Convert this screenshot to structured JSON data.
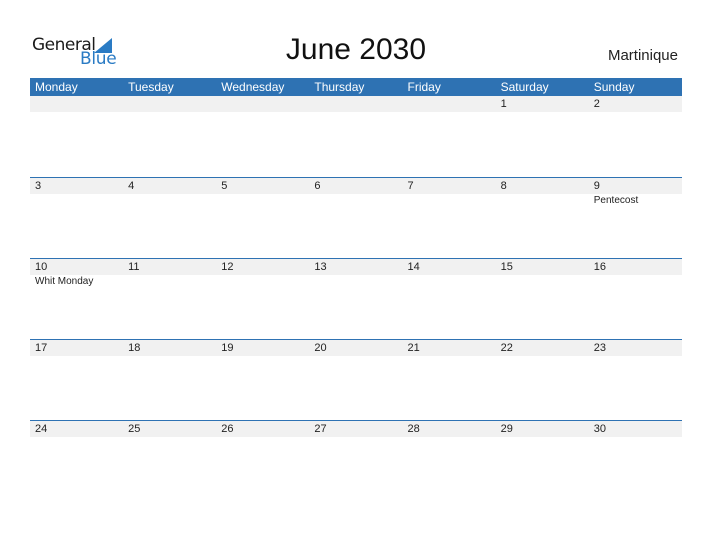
{
  "logo": {
    "line1": "General",
    "line2": "Blue",
    "accent_color": "#2a7bc4"
  },
  "title": "June 2030",
  "country": "Martinique",
  "header_color": "#2e72b3",
  "weekdays": [
    "Monday",
    "Tuesday",
    "Wednesday",
    "Thursday",
    "Friday",
    "Saturday",
    "Sunday"
  ],
  "weeks": [
    {
      "days": [
        "",
        "",
        "",
        "",
        "",
        "1",
        "2"
      ],
      "events": [
        "",
        "",
        "",
        "",
        "",
        "",
        ""
      ]
    },
    {
      "days": [
        "3",
        "4",
        "5",
        "6",
        "7",
        "8",
        "9"
      ],
      "events": [
        "",
        "",
        "",
        "",
        "",
        "",
        "Pentecost"
      ]
    },
    {
      "days": [
        "10",
        "11",
        "12",
        "13",
        "14",
        "15",
        "16"
      ],
      "events": [
        "Whit Monday",
        "",
        "",
        "",
        "",
        "",
        ""
      ]
    },
    {
      "days": [
        "17",
        "18",
        "19",
        "20",
        "21",
        "22",
        "23"
      ],
      "events": [
        "",
        "",
        "",
        "",
        "",
        "",
        ""
      ]
    },
    {
      "days": [
        "24",
        "25",
        "26",
        "27",
        "28",
        "29",
        "30"
      ],
      "events": [
        "",
        "",
        "",
        "",
        "",
        "",
        ""
      ]
    }
  ]
}
